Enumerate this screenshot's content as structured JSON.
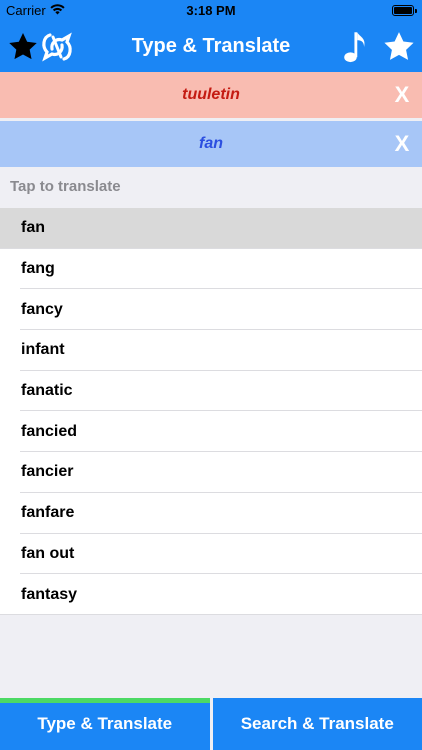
{
  "status_bar": {
    "carrier": "Carrier",
    "time": "3:18 PM"
  },
  "nav": {
    "title": "Type & Translate",
    "left_icons": [
      "star-icon",
      "app-logo-icon"
    ],
    "right_icons": [
      "music-note-icon",
      "star-icon"
    ]
  },
  "source_banner": {
    "text": "tuuletin",
    "close_label": "X"
  },
  "target_banner": {
    "text": "fan",
    "close_label": "X"
  },
  "list_header": "Tap to translate",
  "suggestions": [
    "fan",
    "fang",
    "fancy",
    "infant",
    "fanatic",
    "fancied",
    "fancier",
    "fanfare",
    "fan out",
    "fantasy"
  ],
  "tabs": [
    "Type & Translate",
    "Search & Translate"
  ],
  "colors": {
    "primary": "#1b86f5",
    "source_bg": "#f9bcb1",
    "source_text": "#c41b12",
    "target_bg": "#a7c6f7",
    "target_text": "#2c4fe0",
    "active_tab_indicator": "#4cd964",
    "selected_row": "#d9d9d9"
  }
}
